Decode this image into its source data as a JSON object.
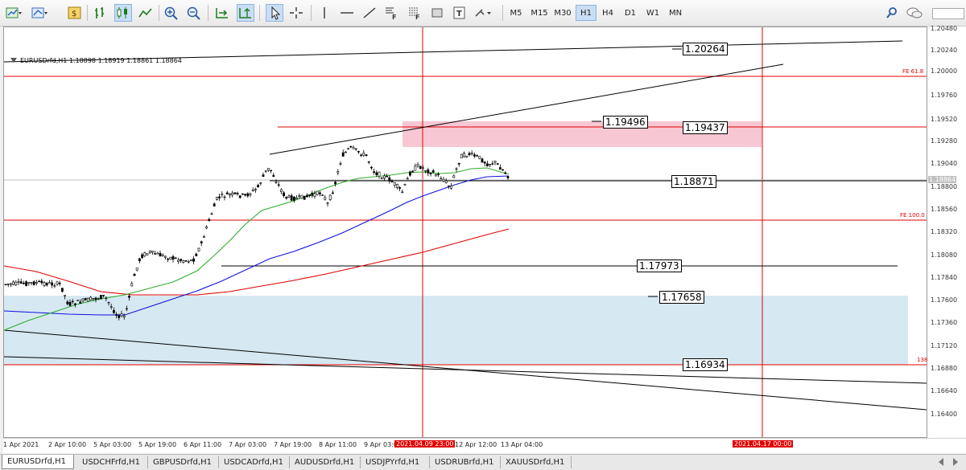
{
  "timeframes": [
    "M5",
    "M15",
    "M30",
    "H1",
    "H4",
    "D1",
    "W1",
    "MN"
  ],
  "active_timeframe": "H1",
  "chart": {
    "symbol_line": "EURUSDrfd,H1  1.18898 1.18919 1.18861 1.18864",
    "price_labels": [
      "1.20480",
      "1.20240",
      "1.20000",
      "1.19760",
      "1.19520",
      "1.19280",
      "1.19040",
      "1.18800",
      "1.18560",
      "1.18320",
      "1.18080",
      "1.17840",
      "1.17600",
      "1.17360",
      "1.17120",
      "1.16880",
      "1.16640",
      "1.16400"
    ],
    "current_price": "1.18864",
    "time_labels": [
      "1 Apr 2021",
      "2 Apr 10:00",
      "5 Apr 03:00",
      "5 Apr 19:00",
      "6 Apr 11:00",
      "7 Apr 03:00",
      "7 Apr 19:00",
      "8 Apr 11:00",
      "9 Apr 03:00",
      "12 Apr 12:00",
      "13 Apr 04:00"
    ],
    "vline_labels": [
      "2021.04.09 23:00",
      "2021.04.17 00:00"
    ],
    "level_boxes": [
      "1.20264",
      "1.19496",
      "1.19437",
      "1.18871",
      "1.17973",
      "1.17658",
      "1.16934"
    ],
    "fe_labels": [
      "FE 61.8",
      "FE 100.0",
      "138"
    ]
  },
  "tabs": [
    "EURUSDrfd,H1",
    "USDCHFrfd,H1",
    "GBPUSDrfd,H1",
    "USDCADrfd,H1",
    "AUDUSDrfd,H1",
    "USDJPYrfd,H1",
    "USDRUBrfd,H1",
    "XAUUSDrfd,H1"
  ],
  "active_tab": "EURUSDrfd,H1",
  "colors": {
    "grid_red": "#e00000",
    "pink_zone": "#f7c7d3",
    "blue_zone": "#d6e8f2",
    "ma_green": "#2fae2f",
    "ma_blue": "#1010e0",
    "ma_red": "#e00000"
  },
  "icons": [
    "new-chart-icon",
    "profiles-icon",
    "market-watch-icon",
    "bar-chart-icon",
    "candlestick-icon",
    "line-chart-icon",
    "zoom-in-icon",
    "zoom-out-icon",
    "autoscroll-icon",
    "chart-shift-icon",
    "cursor-icon",
    "crosshair-icon",
    "vertical-line-icon",
    "horizontal-line-icon",
    "trendline-icon",
    "fibonacci-fan-icon",
    "fibonacci-grid-icon",
    "rectangle-icon",
    "text-icon",
    "shapes-icon",
    "search-icon",
    "chat-icon"
  ]
}
